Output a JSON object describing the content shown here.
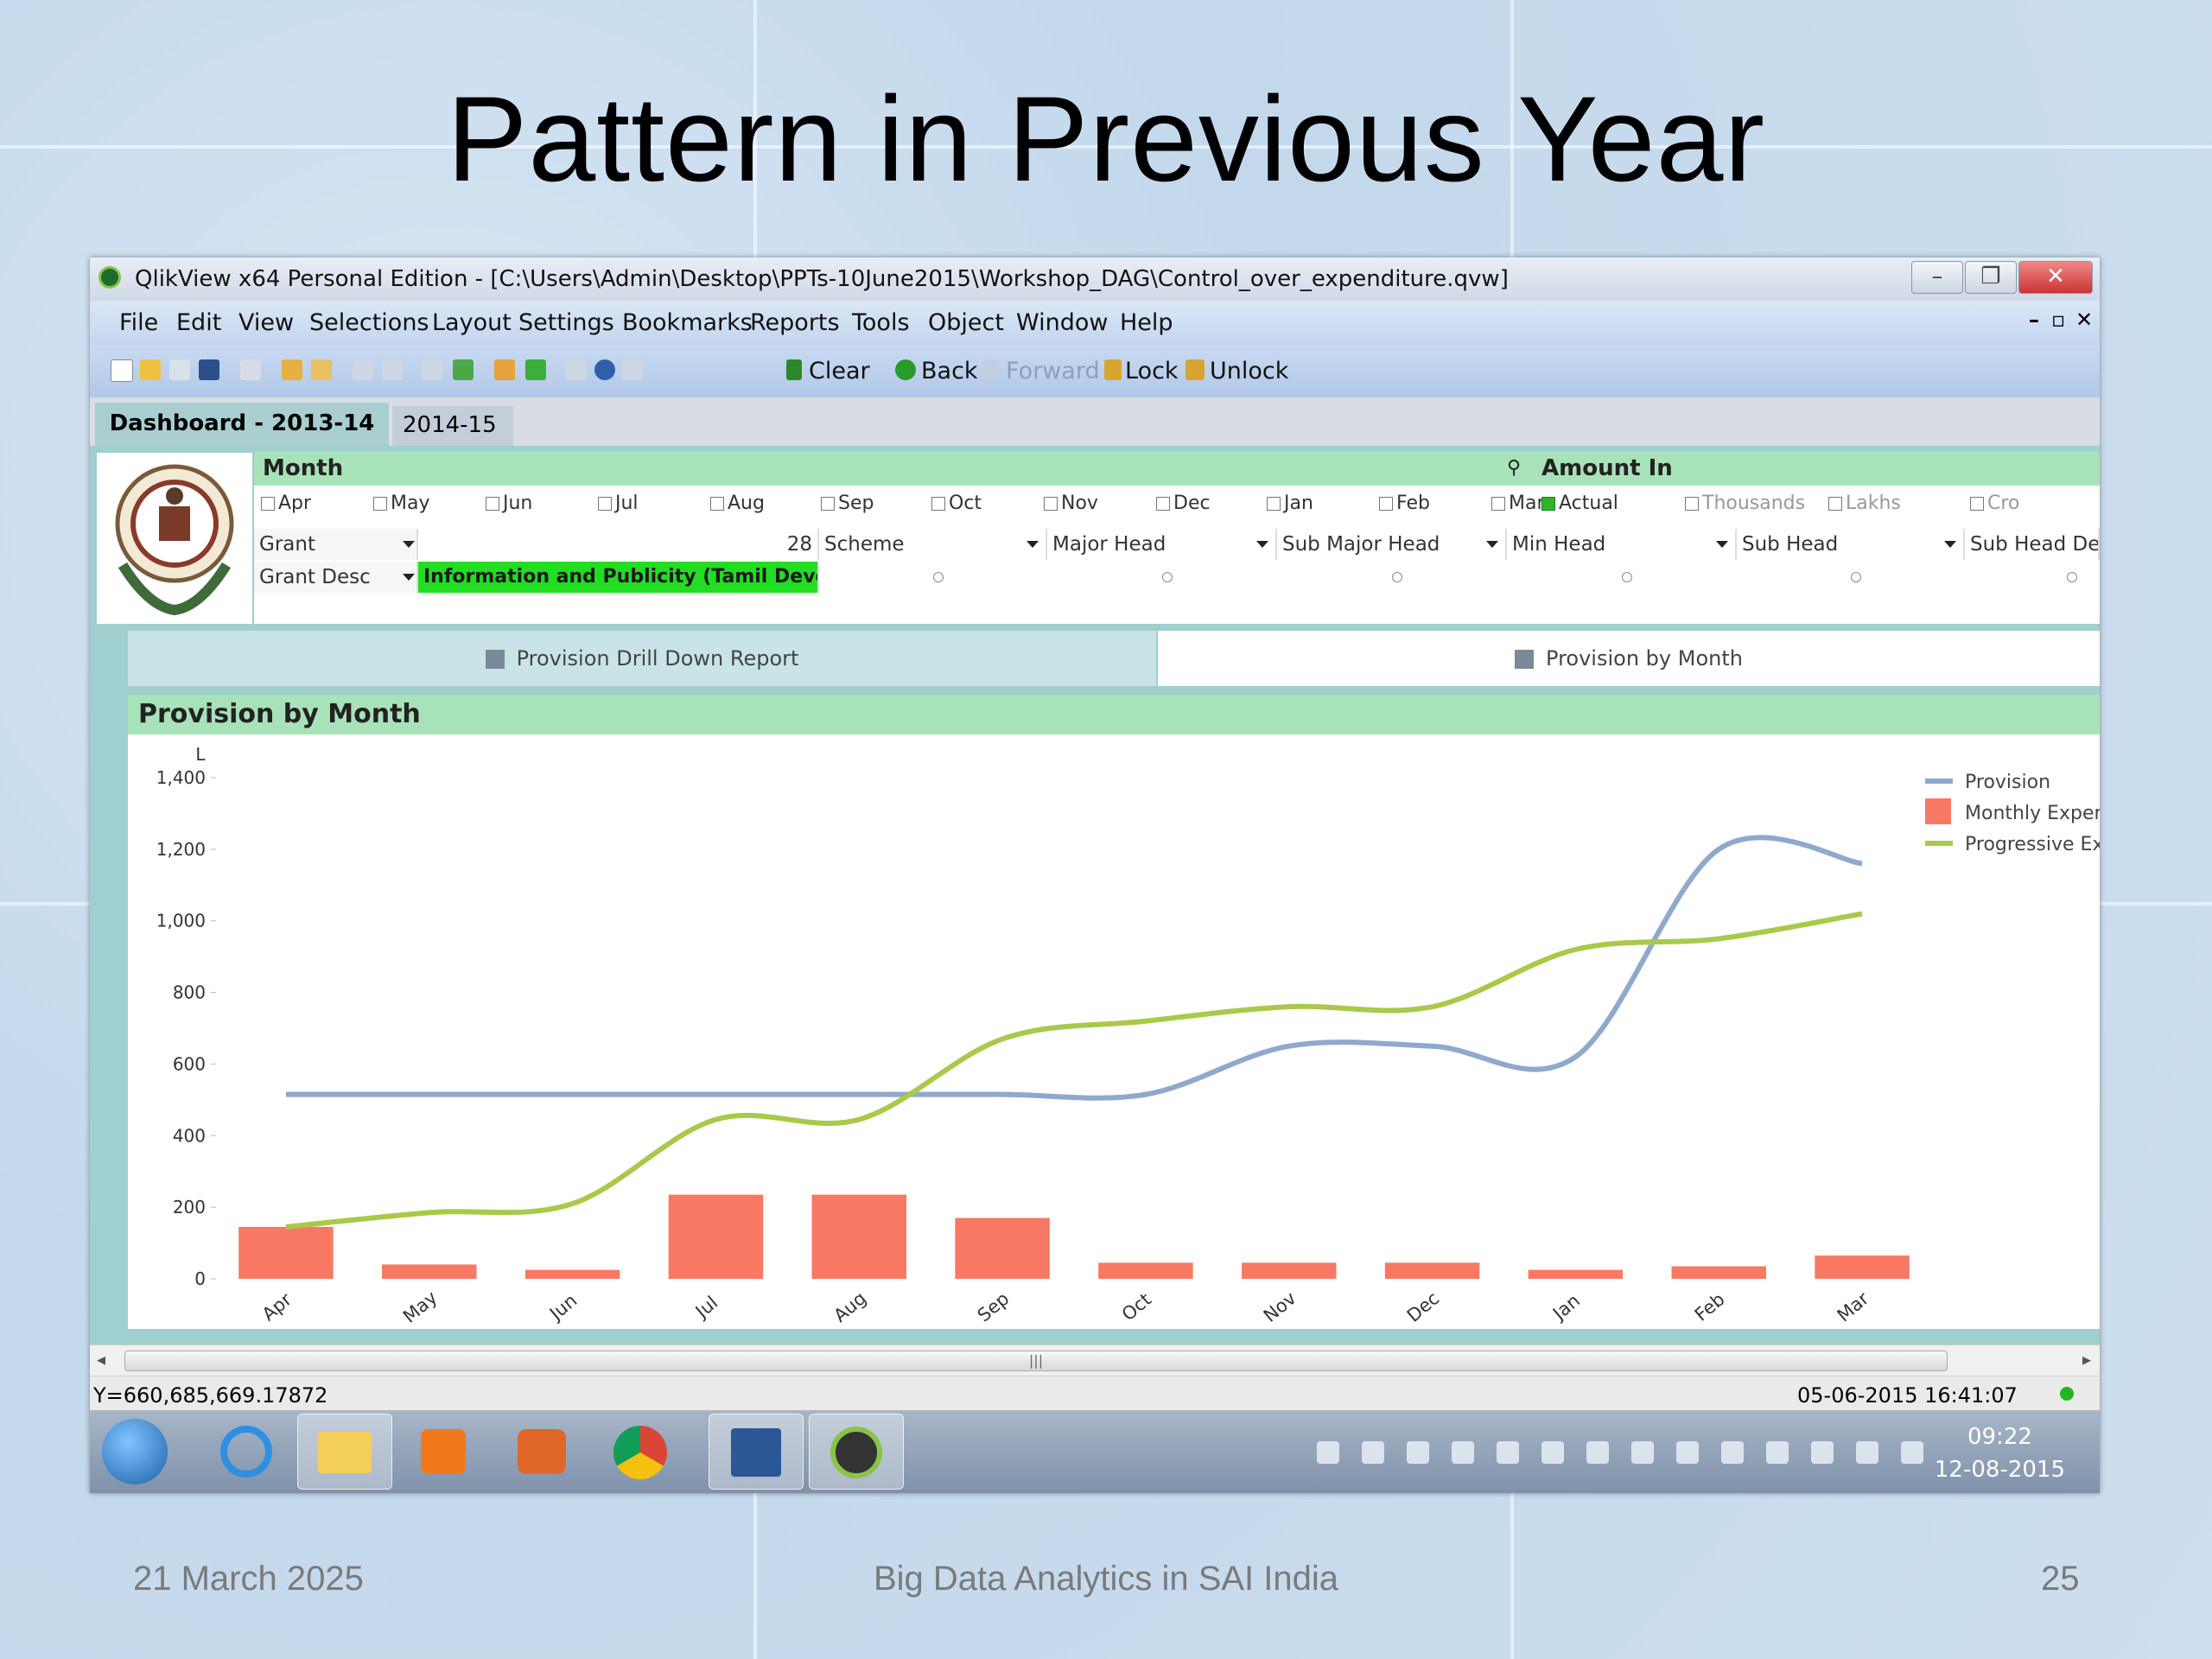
{
  "slide": {
    "title": "Pattern in Previous Year",
    "footer_date": "21 March 2025",
    "footer_center": "Big Data Analytics in SAI India",
    "page_number": "25"
  },
  "window": {
    "title": "QlikView x64 Personal Edition - [C:\\Users\\Admin\\Desktop\\PPTs-10June2015\\Workshop_DAG\\Control_over_expenditure.qvw]",
    "menu": [
      "File",
      "Edit",
      "View",
      "Selections",
      "Layout",
      "Settings",
      "Bookmarks",
      "Reports",
      "Tools",
      "Object",
      "Window",
      "Help"
    ],
    "toolbar": {
      "clear": "Clear",
      "back": "Back",
      "forward": "Forward",
      "lock": "Lock",
      "unlock": "Unlock"
    },
    "tabs": [
      "Dashboard - 2013-14",
      "2014-15"
    ]
  },
  "filters": {
    "month_label": "Month",
    "months": [
      "Apr",
      "May",
      "Jun",
      "Jul",
      "Aug",
      "Sep",
      "Oct",
      "Nov",
      "Dec",
      "Jan",
      "Feb",
      "Mar"
    ],
    "amount_label": "Amount In",
    "amount_options": [
      {
        "label": "Actual",
        "selected": true
      },
      {
        "label": "Thousands",
        "selected": false
      },
      {
        "label": "Lakhs",
        "selected": false
      },
      {
        "label": "Cro",
        "selected": false
      }
    ],
    "grant_label": "Grant",
    "grant_value": "28",
    "grant_desc_label": "Grant Desc",
    "grant_desc_value": "Information and Publicity (Tamil Deve...",
    "columns": [
      "Scheme",
      "Major Head",
      "Sub Major Head",
      "Min Head",
      "Sub Head",
      "Sub Head Desc"
    ]
  },
  "reports": {
    "left": "Provision Drill Down Report",
    "right": "Provision by Month"
  },
  "chart_title": "Provision by Month",
  "chart_data": {
    "type": "bar+line",
    "title": "Provision by Month",
    "ylabel": "L",
    "ylim": [
      0,
      1400
    ],
    "yticks": [
      0,
      200,
      400,
      600,
      800,
      1000,
      1200,
      1400
    ],
    "ytick_labels": [
      "0",
      "200",
      "400",
      "600",
      "800",
      "1,000",
      "1,200",
      "1,400"
    ],
    "categories": [
      "Apr",
      "May",
      "Jun",
      "Jul",
      "Aug",
      "Sep",
      "Oct",
      "Nov",
      "Dec",
      "Jan",
      "Feb",
      "Mar"
    ],
    "series": [
      {
        "name": "Provision",
        "kind": "line",
        "color": "#8fa9cc",
        "values": [
          515,
          515,
          515,
          515,
          515,
          515,
          515,
          650,
          650,
          620,
          1200,
          1160
        ]
      },
      {
        "name": "Monthly Exper",
        "kind": "bar",
        "color": "#f87864",
        "values": [
          145,
          40,
          25,
          235,
          235,
          170,
          45,
          45,
          45,
          25,
          35,
          65
        ]
      },
      {
        "name": "Progressive Ex",
        "kind": "line",
        "color": "#a9c94a",
        "values": [
          145,
          185,
          210,
          445,
          445,
          670,
          720,
          760,
          760,
          920,
          950,
          1020
        ]
      }
    ],
    "legend_position": "right",
    "grid": false
  },
  "status": {
    "left": "Y=660,685,669.17872",
    "datetime": "05-06-2015 16:41:07"
  },
  "taskbar": {
    "time": "09:22",
    "date": "12-08-2015"
  },
  "colors": {
    "header_green": "#a8e2b8",
    "selected_green": "#22dd22",
    "sheet_teal": "#9fcfcf"
  }
}
